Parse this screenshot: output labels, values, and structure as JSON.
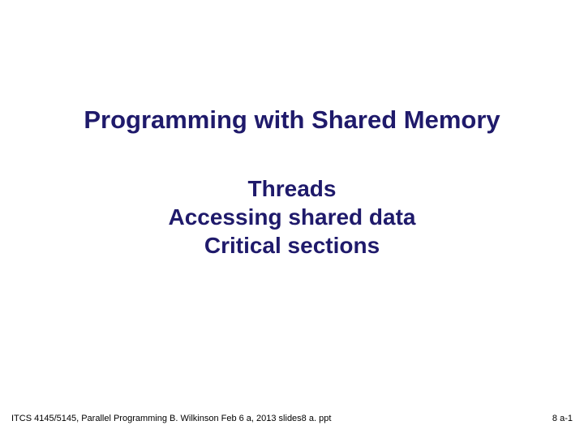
{
  "title": "Programming with Shared Memory",
  "subtitle_line1": "Threads",
  "subtitle_line2": "Accessing shared data",
  "subtitle_line3": "Critical sections",
  "footer_left": "ITCS 4145/5145, Parallel Programming  B. Wilkinson Feb 6 a, 2013  slides8 a. ppt",
  "footer_right": "8 a-1"
}
